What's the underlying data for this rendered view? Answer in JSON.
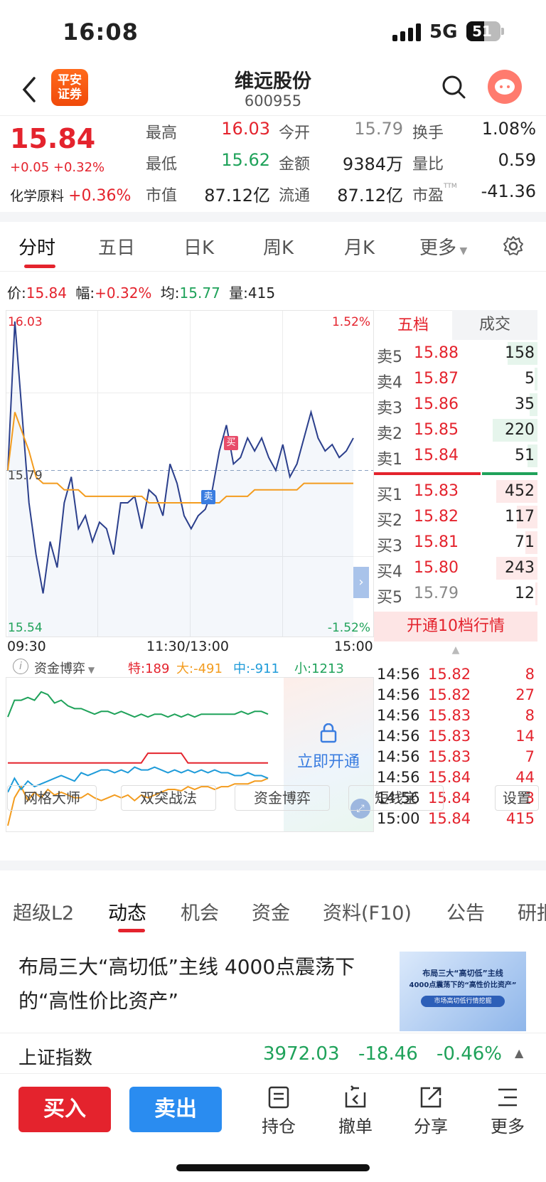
{
  "status": {
    "time": "16:08",
    "network": "5G",
    "battery": "51"
  },
  "header": {
    "logo_line1": "平安",
    "logo_line2": "证券",
    "title": "维远股份",
    "code": "600955"
  },
  "quote": {
    "price": "15.84",
    "change": "+0.05 +0.32%",
    "sector_name": "化学原料",
    "sector_change": "+0.36%",
    "fields": [
      {
        "label": "最高",
        "value": "16.03",
        "color": "red"
      },
      {
        "label": "今开",
        "value": "15.79",
        "color": "gray"
      },
      {
        "label": "换手",
        "value": "1.08%",
        "color": "black"
      },
      {
        "label": "最低",
        "value": "15.62",
        "color": "green"
      },
      {
        "label": "金额",
        "value": "9384万",
        "color": "black"
      },
      {
        "label": "量比",
        "value": "0.59",
        "color": "black"
      },
      {
        "label": "市值",
        "value": "87.12亿",
        "color": "black"
      },
      {
        "label": "流通",
        "value": "87.12亿",
        "color": "black"
      },
      {
        "label": "市盈",
        "value": "-41.36",
        "color": "black"
      }
    ],
    "ttm": "TTM"
  },
  "tabs": [
    "分时",
    "五日",
    "日K",
    "周K",
    "月K",
    "更多"
  ],
  "price_line": {
    "price_label": "价:",
    "price": "15.84",
    "amp_label": "幅:",
    "amp": "+0.32%",
    "avg_label": "均:",
    "avg": "15.77",
    "vol_label": "量:",
    "vol": "415"
  },
  "chart_data": [
    {
      "type": "line",
      "title": "",
      "ylim": [
        15.54,
        16.03
      ],
      "y_left_ticks": [
        "16.03",
        "15.79",
        "15.54"
      ],
      "y_right_ticks": [
        "1.52%",
        "-1.52%"
      ],
      "x_ticks": [
        "09:30",
        "11:30/13:00",
        "15:00"
      ],
      "prev_close": 15.79,
      "series": [
        {
          "name": "价",
          "color": "#2b3f8c",
          "values": [
            15.79,
            16.02,
            15.88,
            15.74,
            15.66,
            15.6,
            15.68,
            15.64,
            15.74,
            15.78,
            15.7,
            15.72,
            15.68,
            15.71,
            15.7,
            15.66,
            15.74,
            15.74,
            15.75,
            15.7,
            15.76,
            15.75,
            15.72,
            15.8,
            15.77,
            15.72,
            15.7,
            15.72,
            15.73,
            15.76,
            15.82,
            15.86,
            15.8,
            15.81,
            15.84,
            15.82,
            15.84,
            15.81,
            15.79,
            15.83,
            15.78,
            15.8,
            15.84,
            15.88,
            15.84,
            15.82,
            15.83,
            15.81,
            15.82,
            15.84
          ]
        },
        {
          "name": "均",
          "color": "#f39c1f",
          "values": [
            15.79,
            15.88,
            15.85,
            15.82,
            15.78,
            15.77,
            15.77,
            15.77,
            15.76,
            15.76,
            15.76,
            15.75,
            15.75,
            15.75,
            15.75,
            15.75,
            15.75,
            15.75,
            15.75,
            15.75,
            15.74,
            15.74,
            15.74,
            15.74,
            15.74,
            15.74,
            15.74,
            15.74,
            15.74,
            15.74,
            15.74,
            15.75,
            15.75,
            15.75,
            15.75,
            15.76,
            15.76,
            15.76,
            15.76,
            15.76,
            15.76,
            15.76,
            15.77,
            15.77,
            15.77,
            15.77,
            15.77,
            15.77,
            15.77,
            15.77
          ]
        }
      ],
      "markers": [
        {
          "label": "买"
        },
        {
          "label": "卖"
        }
      ]
    },
    {
      "type": "line",
      "title": "资金博弈",
      "series": [
        {
          "name": "特",
          "value_label": "189",
          "color": "#e4232d",
          "values": [
            0.45,
            0.45,
            0.45,
            0.45,
            0.45,
            0.45,
            0.45,
            0.45,
            0.45,
            0.45,
            0.45,
            0.45,
            0.45,
            0.45,
            0.45,
            0.45,
            0.45,
            0.45,
            0.45,
            0.45,
            0.45,
            0.52,
            0.52,
            0.52,
            0.52,
            0.52,
            0.52,
            0.45,
            0.45,
            0.45,
            0.45,
            0.45,
            0.45,
            0.45,
            0.45,
            0.45,
            0.45,
            0.45,
            0.45,
            0.45
          ]
        },
        {
          "name": "大",
          "value_label": "-491",
          "color": "#f39c1f",
          "values": [
            0.0,
            0.2,
            0.28,
            0.18,
            0.24,
            0.2,
            0.26,
            0.22,
            0.24,
            0.22,
            0.2,
            0.2,
            0.23,
            0.2,
            0.18,
            0.2,
            0.22,
            0.2,
            0.22,
            0.18,
            0.22,
            0.2,
            0.22,
            0.24,
            0.26,
            0.26,
            0.25,
            0.28,
            0.26,
            0.28,
            0.28,
            0.26,
            0.28,
            0.28,
            0.3,
            0.3,
            0.3,
            0.32,
            0.32,
            0.34
          ]
        },
        {
          "name": "中",
          "value_label": "-911",
          "color": "#1e9bd9",
          "values": [
            0.24,
            0.34,
            0.26,
            0.32,
            0.28,
            0.3,
            0.32,
            0.34,
            0.36,
            0.34,
            0.32,
            0.38,
            0.36,
            0.38,
            0.4,
            0.4,
            0.38,
            0.4,
            0.38,
            0.42,
            0.4,
            0.4,
            0.42,
            0.4,
            0.38,
            0.4,
            0.38,
            0.4,
            0.38,
            0.4,
            0.38,
            0.4,
            0.38,
            0.38,
            0.36,
            0.36,
            0.38,
            0.36,
            0.36,
            0.34
          ]
        },
        {
          "name": "小",
          "value_label": "1213",
          "color": "#1fa25a",
          "values": [
            0.78,
            0.9,
            0.9,
            0.92,
            0.9,
            0.96,
            0.94,
            0.88,
            0.9,
            0.86,
            0.84,
            0.84,
            0.82,
            0.8,
            0.82,
            0.82,
            0.8,
            0.82,
            0.8,
            0.78,
            0.8,
            0.78,
            0.8,
            0.8,
            0.78,
            0.8,
            0.78,
            0.8,
            0.78,
            0.8,
            0.8,
            0.8,
            0.8,
            0.8,
            0.8,
            0.82,
            0.8,
            0.82,
            0.82,
            0.8
          ]
        }
      ]
    }
  ],
  "lock": {
    "text": "立即开通"
  },
  "book": {
    "tab_active": "五档",
    "tab_other": "成交",
    "sells": [
      {
        "label": "卖5",
        "price": "15.88",
        "vol": "158",
        "bar": 0.6
      },
      {
        "label": "卖4",
        "price": "15.87",
        "vol": "5",
        "bar": 0.05
      },
      {
        "label": "卖3",
        "price": "15.86",
        "vol": "35",
        "bar": 0.15
      },
      {
        "label": "卖2",
        "price": "15.85",
        "vol": "220",
        "bar": 0.9
      },
      {
        "label": "卖1",
        "price": "15.84",
        "vol": "51",
        "bar": 0.2
      }
    ],
    "buys": [
      {
        "label": "买1",
        "price": "15.83",
        "vol": "452",
        "bar": 1.0
      },
      {
        "label": "买2",
        "price": "15.82",
        "vol": "117",
        "bar": 0.5
      },
      {
        "label": "买3",
        "price": "15.81",
        "vol": "71",
        "bar": 0.3
      },
      {
        "label": "买4",
        "price": "15.80",
        "vol": "243",
        "bar": 1.0
      },
      {
        "label": "买5",
        "price": "15.79",
        "vol": "12",
        "bar": 0.05
      }
    ],
    "open10": "开通10档行情"
  },
  "trades": [
    {
      "time": "14:56",
      "price": "15.82",
      "vol": "8"
    },
    {
      "time": "14:56",
      "price": "15.82",
      "vol": "27"
    },
    {
      "time": "14:56",
      "price": "15.83",
      "vol": "8"
    },
    {
      "time": "14:56",
      "price": "15.83",
      "vol": "14"
    },
    {
      "time": "14:56",
      "price": "15.83",
      "vol": "7"
    },
    {
      "time": "14:56",
      "price": "15.84",
      "vol": "44"
    },
    {
      "time": "14:56",
      "price": "15.84",
      "vol": "3"
    },
    {
      "time": "15:00",
      "price": "15.84",
      "vol": "415"
    }
  ],
  "tools": [
    "网格大师",
    "双突战法",
    "资金博弈",
    "短线宝",
    "设置"
  ],
  "subtabs": [
    "超级L2",
    "动态",
    "机会",
    "资金",
    "资料(F10)",
    "公告",
    "研报"
  ],
  "news": {
    "title": "布局三大“高切低”主线 4000点震荡下的“高性价比资产”",
    "thumb_line1": "布局三大“高切低”主线",
    "thumb_line2": "4000点震荡下的“高性价比资产”",
    "thumb_tag": "市场高切低行情挖掘"
  },
  "index": {
    "name": "上证指数",
    "value": "3972.03",
    "change": "-18.46",
    "pct": "-0.46%"
  },
  "bottom": {
    "buy": "买入",
    "sell": "卖出",
    "b1": "持仓",
    "b2": "撤单",
    "b3": "分享",
    "b4": "更多"
  }
}
